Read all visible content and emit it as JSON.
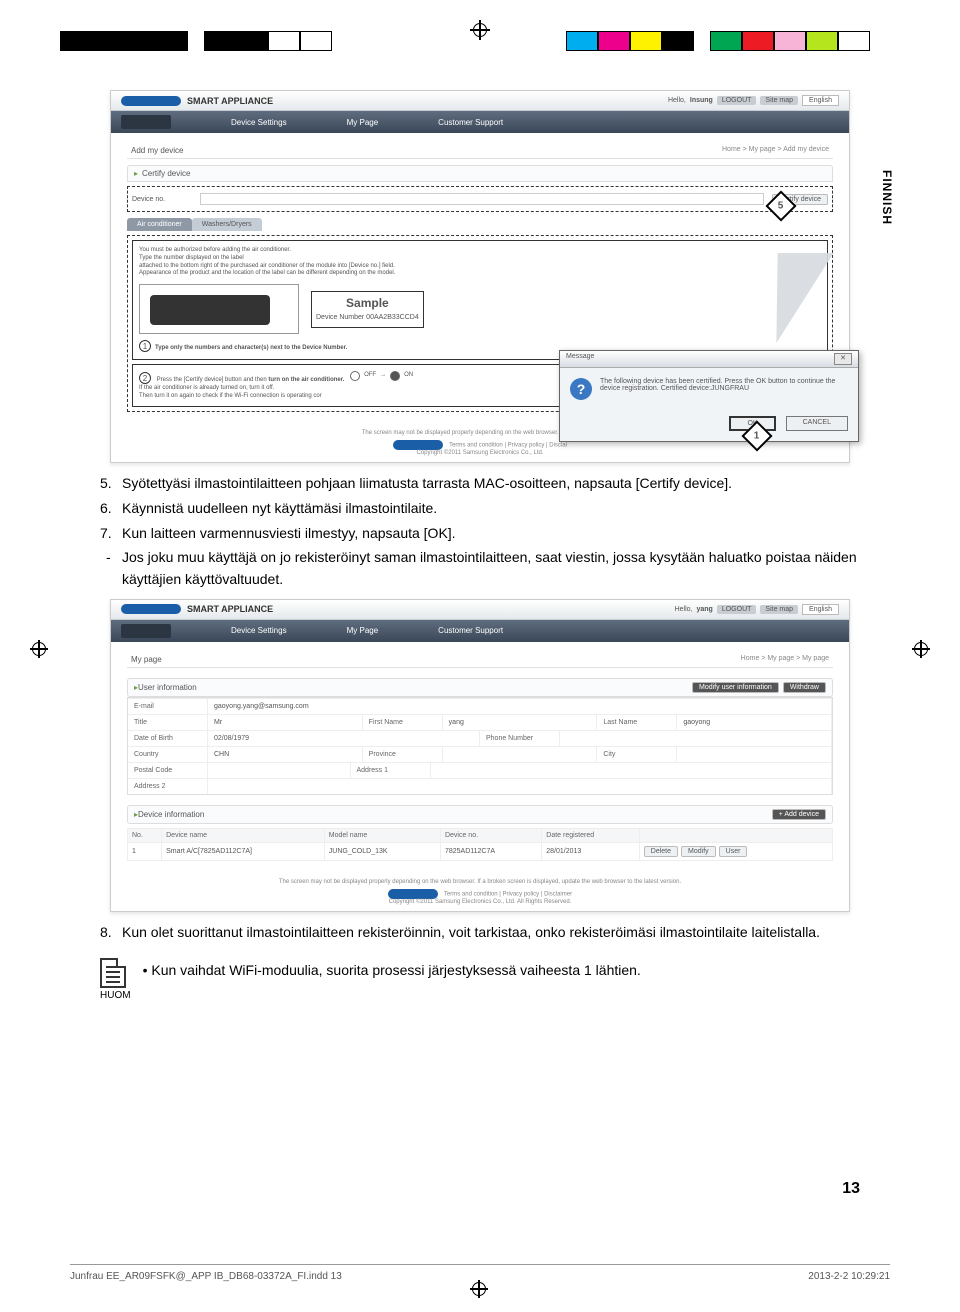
{
  "registration": {
    "left_colors": [
      "#000",
      "#000",
      "#000",
      "#000",
      "#000",
      "#000",
      "#fff",
      "#fff"
    ],
    "right_colors": [
      "#00aeef",
      "#ec008c",
      "#fff200",
      "#000",
      "#00a651",
      "#ed1c24",
      "#ffaec9",
      "#b5e61d",
      "#fff"
    ]
  },
  "side_tab": "FINNISH",
  "shot1": {
    "brand": "SMART APPLIANCE",
    "hello": "Hello,",
    "user": "Insung",
    "logout": "LOGOUT",
    "sitemap": "Site map",
    "lang": "English",
    "nav": [
      "Device Settings",
      "My Page",
      "Customer Support"
    ],
    "page_title": "Add my device",
    "breadcrumb": "Home > My page > Add my device",
    "certify_panel": "Certify device",
    "device_no_label": "Device no.",
    "certify_btn": "Certify device",
    "marker5": "5",
    "tab_ac": "Air conditioner",
    "tab_wd": "Washers/Dryers",
    "auth_line1": "You must be authorized before adding the air conditioner.",
    "auth_line2": "Type the number displayed on the label",
    "auth_line3": "attached to the bottom right of the purchased air conditioner of the module into [Device no.] field.",
    "auth_line4": "Appearance of the product and the location of the label can be different depending on the model.",
    "sample": "Sample",
    "device_number": "Device Number 00AA2B33CCD4",
    "step1": "Type only the numbers and character(s) next to the Device Number.",
    "step2a": "Press the [Certify device] button and then",
    "step2b": "turn on the air conditioner.",
    "step2c": "If the air conditioner is already turned on, turn it off.",
    "step2d": "Then turn it on again to check if the Wi-Fi connection is operating cor",
    "off": "OFF",
    "on": "ON",
    "screen_note": "The screen may not be displayed properly depending on the web browser. If a broken scr",
    "foot_terms": "Terms and condition | Privacy policy | Disclai",
    "foot_copy": "Copyright ©2011 Samsung Electronics Co., Ltd.",
    "dialog_title": "Message",
    "dialog_text": "The following device has been certified. Press the OK button to continue the device registration. Certified device:JUNGFRAU",
    "ok": "OK",
    "cancel": "CANCEL",
    "marker1": "1"
  },
  "instr": {
    "i5": "Syötettyäsi ilmastointilaitteen pohjaan liimatusta tarrasta MAC-osoitteen, napsauta [Certify device].",
    "i6": "Käynnistä uudelleen nyt käyttämäsi ilmastointilaite.",
    "i7": "Kun laitteen varmennusviesti ilmestyy, napsauta [OK].",
    "i7a": "Jos joku muu käyttäjä on jo rekisteröinyt saman ilmastointilaitteen, saat viestin, jossa kysytään haluatko poistaa näiden käyttäjien käyttövaltuudet."
  },
  "shot2": {
    "brand": "SMART APPLIANCE",
    "hello": "Hello,",
    "user": "yang",
    "logout": "LOGOUT",
    "sitemap": "Site map",
    "lang": "English",
    "nav": [
      "Device Settings",
      "My Page",
      "Customer Support"
    ],
    "page_title": "My page",
    "breadcrumb": "Home > My page > My page",
    "user_info_hdr": "User information",
    "btn_modify_user": "Modify user information",
    "btn_withdraw": "Withdraw",
    "fields": {
      "email_l": "E-mail",
      "email_v": "gaoyong.yang@samsung.com",
      "title_l": "Title",
      "title_v": "Mr",
      "fn_l": "First Name",
      "fn_v": "yang",
      "ln_l": "Last Name",
      "ln_v": "gaoyong",
      "dob_l": "Date of Birth",
      "dob_v": "02/08/1979",
      "phone_l": "Phone Number",
      "country_l": "Country",
      "country_v": "CHN",
      "prov_l": "Province",
      "city_l": "City",
      "postal_l": "Postal Code",
      "addr1_l": "Address 1",
      "addr2_l": "Address 2"
    },
    "dev_info_hdr": "Device information",
    "btn_add_device": "+ Add device",
    "th": [
      "No.",
      "Device name",
      "Model name",
      "Device no.",
      "Date registered",
      ""
    ],
    "row": [
      "1",
      "Smart A/C[7825AD112C7A]",
      "JUNG_COLD_13K",
      "7825AD112C7A",
      "28/01/2013"
    ],
    "row_btns": [
      "Delete",
      "Modify",
      "User"
    ],
    "screen_note": "The screen may not be displayed properly depending on the web browser. If a broken screen is displayed, update the web browser to the latest version.",
    "foot_terms": "Terms and condition | Privacy policy | Disclaimer",
    "foot_copy": "Copyright ©2011 Samsung Electronics Co., Ltd. All Rights Reserved."
  },
  "instr2": {
    "i8": "Kun olet suorittanut ilmastointilaitteen rekisteröinnin, voit tarkistaa, onko rekisteröimäsi ilmastointilaite laitelistalla."
  },
  "note": {
    "label": "HUOM",
    "bullet": "•",
    "text": "Kun vaihdat WiFi-moduulia, suorita prosessi järjestyksessä vaiheesta 1 lähtien."
  },
  "page_number": "13",
  "imprint_left": "Junfrau EE_AR09FSFK@_APP IB_DB68-03372A_FI.indd   13",
  "imprint_right": "2013-2-2   10:29:21"
}
